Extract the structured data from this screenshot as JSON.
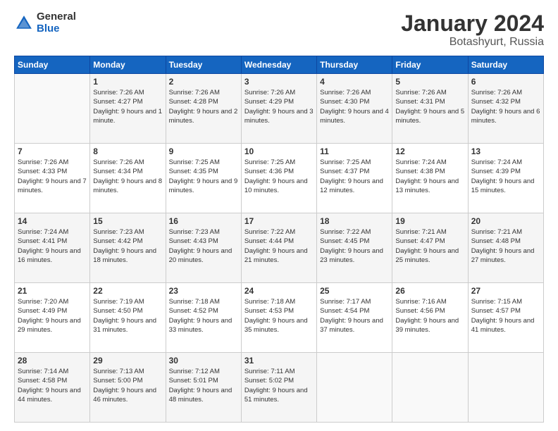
{
  "header": {
    "logo_general": "General",
    "logo_blue": "Blue",
    "month": "January 2024",
    "location": "Botashyurt, Russia"
  },
  "weekdays": [
    "Sunday",
    "Monday",
    "Tuesday",
    "Wednesday",
    "Thursday",
    "Friday",
    "Saturday"
  ],
  "weeks": [
    [
      {
        "day": "",
        "sunrise": "",
        "sunset": "",
        "daylight": ""
      },
      {
        "day": "1",
        "sunrise": "7:26 AM",
        "sunset": "4:27 PM",
        "daylight": "9 hours and 1 minute."
      },
      {
        "day": "2",
        "sunrise": "7:26 AM",
        "sunset": "4:28 PM",
        "daylight": "9 hours and 2 minutes."
      },
      {
        "day": "3",
        "sunrise": "7:26 AM",
        "sunset": "4:29 PM",
        "daylight": "9 hours and 3 minutes."
      },
      {
        "day": "4",
        "sunrise": "7:26 AM",
        "sunset": "4:30 PM",
        "daylight": "9 hours and 4 minutes."
      },
      {
        "day": "5",
        "sunrise": "7:26 AM",
        "sunset": "4:31 PM",
        "daylight": "9 hours and 5 minutes."
      },
      {
        "day": "6",
        "sunrise": "7:26 AM",
        "sunset": "4:32 PM",
        "daylight": "9 hours and 6 minutes."
      }
    ],
    [
      {
        "day": "7",
        "sunrise": "7:26 AM",
        "sunset": "4:33 PM",
        "daylight": "9 hours and 7 minutes."
      },
      {
        "day": "8",
        "sunrise": "7:26 AM",
        "sunset": "4:34 PM",
        "daylight": "9 hours and 8 minutes."
      },
      {
        "day": "9",
        "sunrise": "7:25 AM",
        "sunset": "4:35 PM",
        "daylight": "9 hours and 9 minutes."
      },
      {
        "day": "10",
        "sunrise": "7:25 AM",
        "sunset": "4:36 PM",
        "daylight": "9 hours and 10 minutes."
      },
      {
        "day": "11",
        "sunrise": "7:25 AM",
        "sunset": "4:37 PM",
        "daylight": "9 hours and 12 minutes."
      },
      {
        "day": "12",
        "sunrise": "7:24 AM",
        "sunset": "4:38 PM",
        "daylight": "9 hours and 13 minutes."
      },
      {
        "day": "13",
        "sunrise": "7:24 AM",
        "sunset": "4:39 PM",
        "daylight": "9 hours and 15 minutes."
      }
    ],
    [
      {
        "day": "14",
        "sunrise": "7:24 AM",
        "sunset": "4:41 PM",
        "daylight": "9 hours and 16 minutes."
      },
      {
        "day": "15",
        "sunrise": "7:23 AM",
        "sunset": "4:42 PM",
        "daylight": "9 hours and 18 minutes."
      },
      {
        "day": "16",
        "sunrise": "7:23 AM",
        "sunset": "4:43 PM",
        "daylight": "9 hours and 20 minutes."
      },
      {
        "day": "17",
        "sunrise": "7:22 AM",
        "sunset": "4:44 PM",
        "daylight": "9 hours and 21 minutes."
      },
      {
        "day": "18",
        "sunrise": "7:22 AM",
        "sunset": "4:45 PM",
        "daylight": "9 hours and 23 minutes."
      },
      {
        "day": "19",
        "sunrise": "7:21 AM",
        "sunset": "4:47 PM",
        "daylight": "9 hours and 25 minutes."
      },
      {
        "day": "20",
        "sunrise": "7:21 AM",
        "sunset": "4:48 PM",
        "daylight": "9 hours and 27 minutes."
      }
    ],
    [
      {
        "day": "21",
        "sunrise": "7:20 AM",
        "sunset": "4:49 PM",
        "daylight": "9 hours and 29 minutes."
      },
      {
        "day": "22",
        "sunrise": "7:19 AM",
        "sunset": "4:50 PM",
        "daylight": "9 hours and 31 minutes."
      },
      {
        "day": "23",
        "sunrise": "7:18 AM",
        "sunset": "4:52 PM",
        "daylight": "9 hours and 33 minutes."
      },
      {
        "day": "24",
        "sunrise": "7:18 AM",
        "sunset": "4:53 PM",
        "daylight": "9 hours and 35 minutes."
      },
      {
        "day": "25",
        "sunrise": "7:17 AM",
        "sunset": "4:54 PM",
        "daylight": "9 hours and 37 minutes."
      },
      {
        "day": "26",
        "sunrise": "7:16 AM",
        "sunset": "4:56 PM",
        "daylight": "9 hours and 39 minutes."
      },
      {
        "day": "27",
        "sunrise": "7:15 AM",
        "sunset": "4:57 PM",
        "daylight": "9 hours and 41 minutes."
      }
    ],
    [
      {
        "day": "28",
        "sunrise": "7:14 AM",
        "sunset": "4:58 PM",
        "daylight": "9 hours and 44 minutes."
      },
      {
        "day": "29",
        "sunrise": "7:13 AM",
        "sunset": "5:00 PM",
        "daylight": "9 hours and 46 minutes."
      },
      {
        "day": "30",
        "sunrise": "7:12 AM",
        "sunset": "5:01 PM",
        "daylight": "9 hours and 48 minutes."
      },
      {
        "day": "31",
        "sunrise": "7:11 AM",
        "sunset": "5:02 PM",
        "daylight": "9 hours and 51 minutes."
      },
      {
        "day": "",
        "sunrise": "",
        "sunset": "",
        "daylight": ""
      },
      {
        "day": "",
        "sunrise": "",
        "sunset": "",
        "daylight": ""
      },
      {
        "day": "",
        "sunrise": "",
        "sunset": "",
        "daylight": ""
      }
    ]
  ]
}
